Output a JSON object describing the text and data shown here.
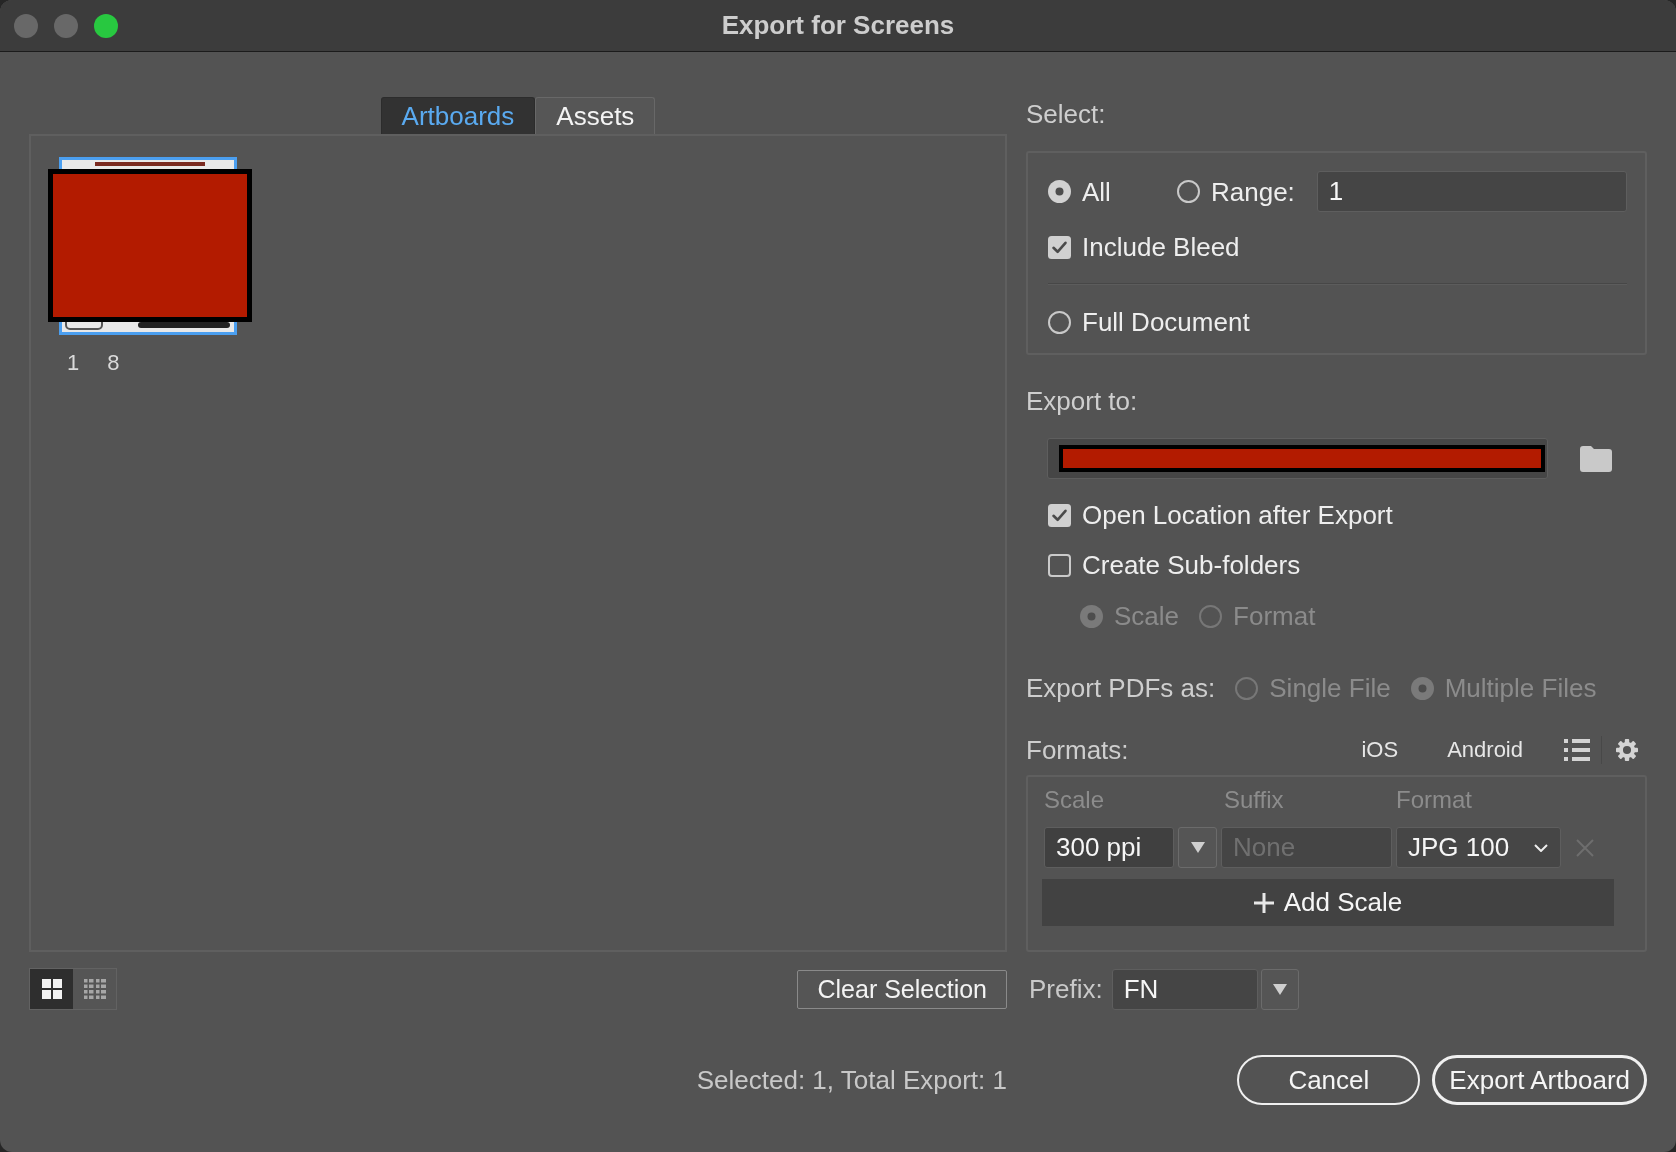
{
  "window": {
    "title": "Export for Screens",
    "controls": [
      {
        "kind": "close",
        "active": false
      },
      {
        "kind": "minimize",
        "active": false
      },
      {
        "kind": "zoom",
        "active": true
      }
    ]
  },
  "tabs": [
    {
      "label": "Artboards",
      "selected": true
    },
    {
      "label": "Assets",
      "selected": false
    }
  ],
  "artboards": [
    {
      "number": "1",
      "name": "8",
      "selected": true
    }
  ],
  "view_modes": [
    {
      "kind": "grid",
      "selected": true
    },
    {
      "kind": "list",
      "selected": false
    }
  ],
  "clear_selection": "Clear Selection",
  "status": "Selected: 1, Total Export: 1",
  "select": {
    "label": "Select:",
    "scope": [
      {
        "label": "All",
        "selected": true
      },
      {
        "label": "Range:",
        "selected": false
      },
      {
        "label": "Full Document",
        "selected": false
      }
    ],
    "range": {
      "value": "1"
    },
    "include_bleed": {
      "label": "Include Bleed",
      "checked": true
    }
  },
  "export_to": {
    "label": "Export to:",
    "open_location": {
      "label": "Open Location after Export",
      "checked": true
    },
    "create_subfolders": {
      "label": "Create Sub-folders",
      "checked": false
    },
    "subfolder_by": [
      {
        "label": "Scale",
        "selected": true,
        "disabled": true
      },
      {
        "label": "Format",
        "selected": false,
        "disabled": true
      }
    ]
  },
  "export_pdfs": {
    "label": "Export PDFs as:",
    "options": [
      {
        "label": "Single File",
        "selected": false,
        "disabled": true
      },
      {
        "label": "Multiple Files",
        "selected": true,
        "disabled": true
      }
    ]
  },
  "formats": {
    "label": "Formats:",
    "presets": [
      "iOS",
      "Android"
    ],
    "columns": [
      "Scale",
      "Suffix",
      "Format"
    ],
    "rows": [
      {
        "scale": "300 ppi",
        "suffix": {
          "placeholder": "None"
        },
        "format": "JPG 100"
      }
    ],
    "add_button": "Add Scale"
  },
  "prefix": {
    "label": "Prefix:",
    "value": "FN"
  },
  "buttons": [
    {
      "label": "Cancel",
      "default": false
    },
    {
      "label": "Export Artboard",
      "default": true
    }
  ]
}
